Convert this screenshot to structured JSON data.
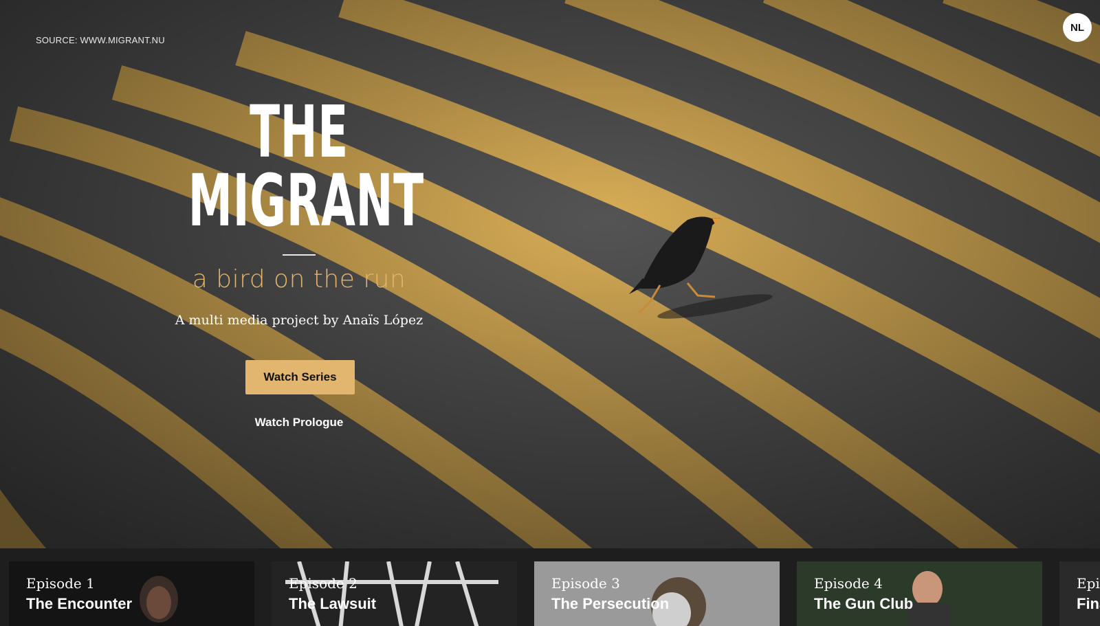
{
  "hero": {
    "source": "SOURCE: WWW.MIGRANT.NU",
    "language_button": "NL",
    "title_line1": "THE",
    "title_line2": "MIGRANT",
    "subtitle": "a bird on the run",
    "byline": "A multi media project by Anaïs López",
    "watch_series_label": "Watch Series",
    "watch_prologue_label": "Watch Prologue"
  },
  "episodes": [
    {
      "number": "Episode 1",
      "title": "The Encounter"
    },
    {
      "number": "Episode 2",
      "title": "The Lawsuit"
    },
    {
      "number": "Episode 3",
      "title": "The Persecution"
    },
    {
      "number": "Episode 4",
      "title": "The Gun Club"
    },
    {
      "number": "Epis",
      "title": "Fina"
    }
  ],
  "colors": {
    "accent": "#e2b66e",
    "subtitle": "#e4b46b",
    "stripe_yellow": "#d8ad56",
    "asphalt": "#4a4a4a",
    "strip_background": "#1e1e1e"
  }
}
